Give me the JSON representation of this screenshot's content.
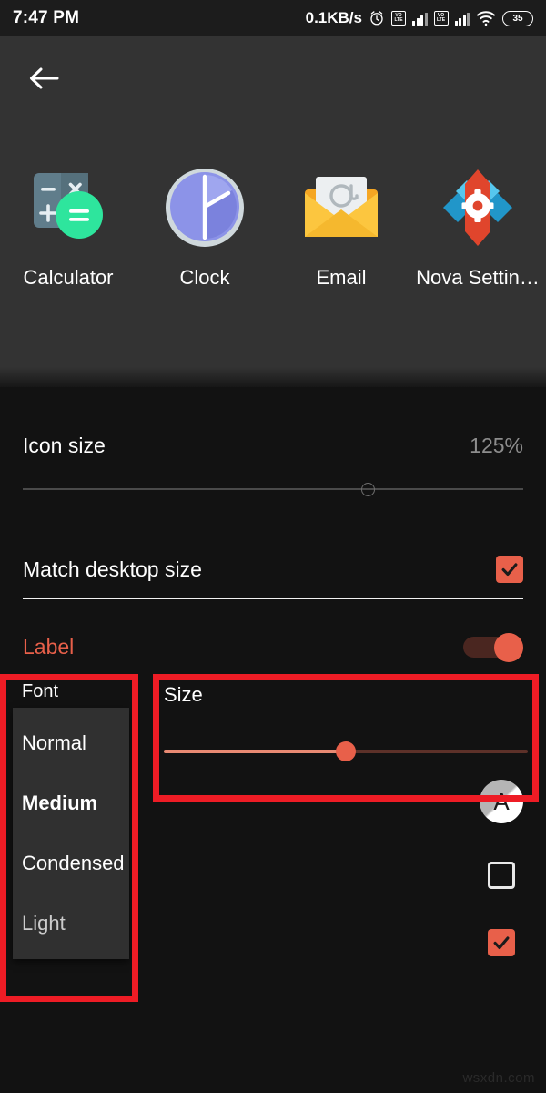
{
  "status_bar": {
    "time": "7:47 PM",
    "network_speed": "0.1KB/s",
    "alarm_icon": "alarm-clock-icon",
    "sim1_label": "VO LTE",
    "sim2_label": "VO LTE",
    "wifi_icon": "wifi-icon",
    "battery_level": "35"
  },
  "header": {
    "back_icon": "back-arrow-icon"
  },
  "preview": {
    "apps": [
      {
        "label": "Calculator",
        "icon": "calculator-icon"
      },
      {
        "label": "Clock",
        "icon": "clock-icon"
      },
      {
        "label": "Email",
        "icon": "email-envelope-icon"
      },
      {
        "label": "Nova Settin…",
        "icon": "nova-settings-icon"
      }
    ]
  },
  "settings": {
    "icon_size": {
      "label": "Icon size",
      "value": "125%",
      "slider_percent": 69
    },
    "match_desktop_size": {
      "label": "Match desktop size",
      "checked": true
    },
    "label_section": {
      "label": "Label",
      "enabled": true
    },
    "font": {
      "title": "Font",
      "options": [
        "Normal",
        "Medium",
        "Condensed",
        "Light"
      ]
    },
    "size": {
      "title": "Size",
      "slider_percent": 50
    },
    "text_color_swatch": {
      "letter": "A"
    },
    "shadow_checkbox": {
      "checked": false
    },
    "single_line_checkbox": {
      "checked": true
    }
  },
  "colors": {
    "accent": "#e8604a",
    "annotation": "#ee1c25",
    "preview_bg": "#333333",
    "settings_bg": "#121212"
  },
  "watermark": "wsxdn.com"
}
